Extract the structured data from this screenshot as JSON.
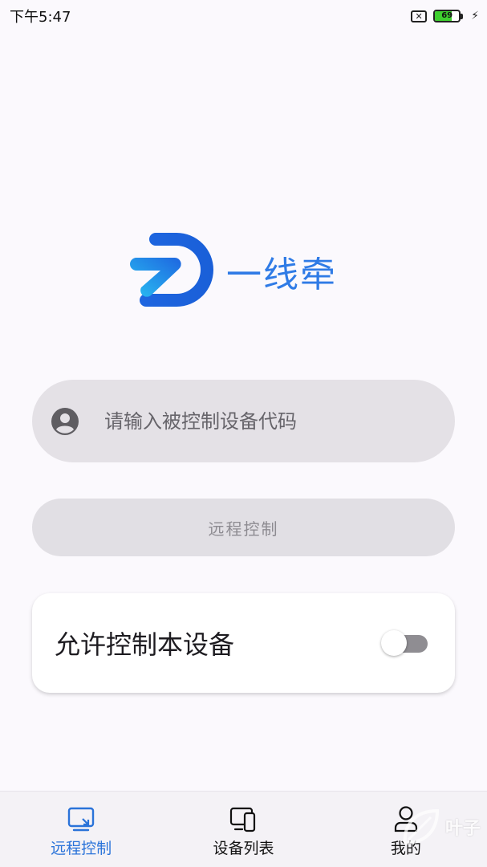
{
  "status_bar": {
    "time": "下午5:47",
    "sim_icon": "sim-off-icon",
    "battery_level": "69",
    "battery_fraction": 0.69,
    "charging_icon": "bolt-icon"
  },
  "logo": {
    "app_name": "一线牵",
    "colors": {
      "primary": "#1e66e0",
      "secondary": "#22b0f0"
    }
  },
  "code_input": {
    "value": "",
    "placeholder": "请输入被控制设备代码",
    "icon": "person-circle-icon"
  },
  "remote_control_button": {
    "label": "远程控制"
  },
  "allow_control": {
    "label": "允许控制本设备",
    "enabled": false
  },
  "bottom_nav": {
    "items": [
      {
        "label": "远程控制",
        "icon": "remote-screen-icon",
        "active": true
      },
      {
        "label": "设备列表",
        "icon": "device-list-icon",
        "active": false
      },
      {
        "label": "我的",
        "icon": "profile-icon",
        "active": false
      }
    ]
  },
  "watermark": {
    "text": "叶子"
  },
  "colors": {
    "accent": "#2a73d9",
    "inactive": "#111111"
  }
}
